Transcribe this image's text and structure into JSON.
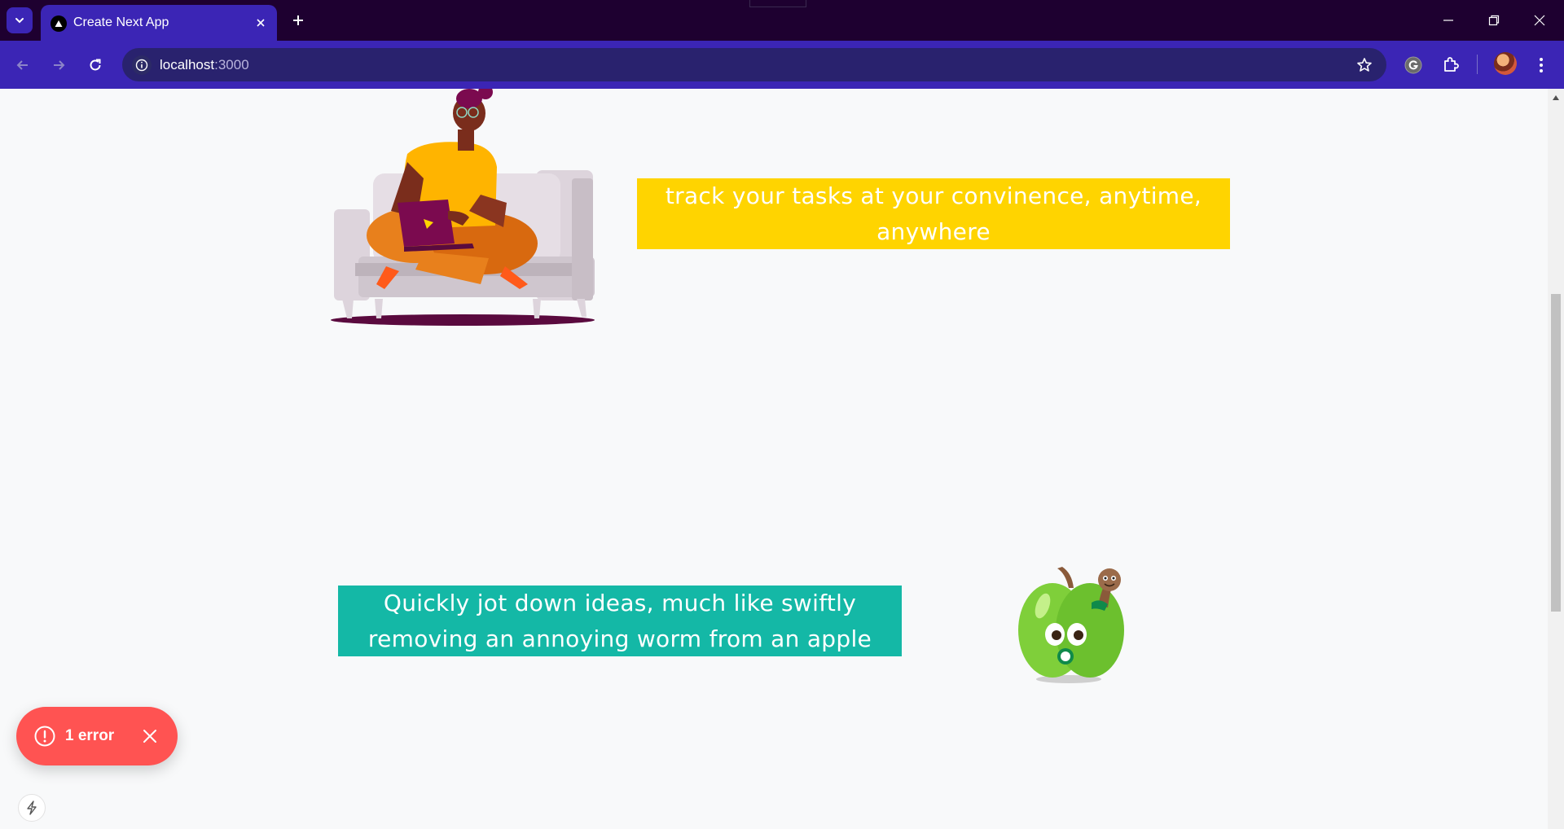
{
  "browser": {
    "tab": {
      "title": "Create Next App"
    },
    "address": {
      "host": "localhost",
      "port": ":3000"
    }
  },
  "content": {
    "banner_top": {
      "text": "track your tasks at your convinence, anytime, anywhere",
      "bg_color": "#ffd400"
    },
    "banner_bottom": {
      "text": "Quickly jot down ideas, much like swiftly removing an annoying worm from an apple",
      "bg_color": "#14b8a6"
    }
  },
  "dev_overlay": {
    "error_label": "1 error",
    "error_color": "#ff5352"
  },
  "icons": {
    "tab_search": "chevron-down-icon",
    "favicon": "triangle-logo-icon",
    "back": "arrow-left-icon",
    "forward": "arrow-right-icon",
    "reload": "reload-icon",
    "site_info": "info-icon",
    "bookmark": "star-icon",
    "grammarly": "grammarly-icon",
    "extensions": "puzzle-icon",
    "menu": "kebab-menu-icon"
  },
  "theme": {
    "chrome_dark": "#1e0030",
    "chrome_accent": "#3b25b5",
    "omnibox": "#29226e"
  }
}
